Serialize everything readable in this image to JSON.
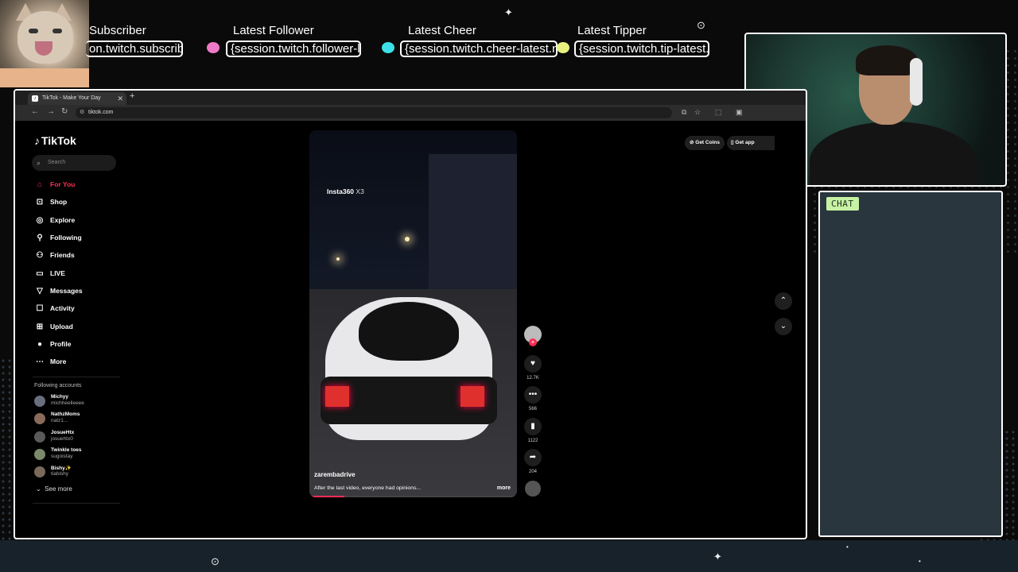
{
  "overlay": {
    "alerts": [
      {
        "label": "Subscriber",
        "value": "on.twitch.subscriber-latest.name}"
      },
      {
        "label": "Latest Follower",
        "value": "{session.twitch.follower-latest.name}"
      },
      {
        "label": "Latest Cheer",
        "value": "{session.twitch.cheer-latest.name}"
      },
      {
        "label": "Latest Tipper",
        "value": "{session.twitch.tip-latest.name}"
      }
    ],
    "chat_label": "CHAT",
    "colors": {
      "pink_heart": "#f07ac8",
      "cyan_heart": "#3ee0e8",
      "yellow_heart": "#e8f080",
      "chat_bg": "#2a363e",
      "chat_badge": "#c7f2a4"
    }
  },
  "browser": {
    "tab_title": "TikTok - Make Your Day",
    "url": "tiktok.com"
  },
  "tiktok": {
    "logo": "TikTok",
    "search_placeholder": "Search",
    "nav": [
      {
        "label": "For You",
        "icon": "home-icon"
      },
      {
        "label": "Shop",
        "icon": "shop-icon"
      },
      {
        "label": "Explore",
        "icon": "compass-icon"
      },
      {
        "label": "Following",
        "icon": "following-icon"
      },
      {
        "label": "Friends",
        "icon": "friends-icon"
      },
      {
        "label": "LIVE",
        "icon": "live-icon"
      },
      {
        "label": "Messages",
        "icon": "messages-icon"
      },
      {
        "label": "Activity",
        "icon": "activity-icon"
      },
      {
        "label": "Upload",
        "icon": "upload-icon"
      },
      {
        "label": "Profile",
        "icon": "profile-icon"
      },
      {
        "label": "More",
        "icon": "more-icon"
      }
    ],
    "following_title": "Following accounts",
    "accounts": [
      {
        "name": "Michyy",
        "user": "michheelleeee"
      },
      {
        "name": "NathzMoms",
        "user": "natz1..."
      },
      {
        "name": "JosueHtx",
        "user": "josuehtx0"
      },
      {
        "name": "Twinkle toes",
        "user": "sugoistay"
      },
      {
        "name": "Bishy✨",
        "user": "tiabishy"
      }
    ],
    "see_more": "See more",
    "get_coins": "Get Coins",
    "get_app": "Get app",
    "video": {
      "overlay_text": "Insta360",
      "overlay_sub": "X3",
      "author": "zarembadrive",
      "caption": "After the last video, everyone had opinions...",
      "more": "more",
      "progress": 0.17
    },
    "actions": {
      "likes": "12.7K",
      "comments": "566",
      "saves": "1122",
      "shares": "204"
    }
  }
}
